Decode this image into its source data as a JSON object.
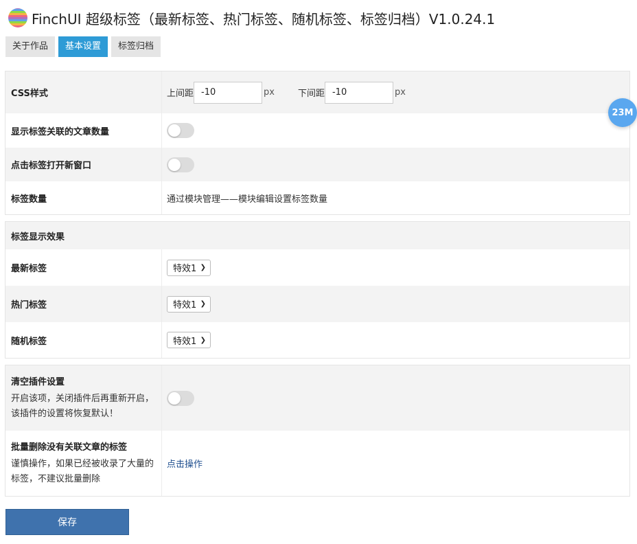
{
  "header": {
    "title": "FinchUI 超级标签（最新标签、热门标签、随机标签、标签归档）V1.0.24.1",
    "logo_icon": "rainbow-sphere-icon"
  },
  "tabs": [
    {
      "label": "关于作品",
      "active": false
    },
    {
      "label": "基本设置",
      "active": true
    },
    {
      "label": "标签归档",
      "active": false
    }
  ],
  "basic": {
    "css_label": "CSS样式",
    "top_margin_label": "上间距",
    "top_margin_value": "-10",
    "bottom_margin_label": "下间距",
    "bottom_margin_value": "-10",
    "unit": "px",
    "show_count_label": "显示标签关联的文章数量",
    "show_count_on": false,
    "new_window_label": "点击标签打开新窗口",
    "new_window_on": false,
    "tag_count_label": "标签数量",
    "tag_count_text": "通过模块管理——模块编辑设置标签数量"
  },
  "effects": {
    "section_title": "标签显示效果",
    "rows": [
      {
        "label": "最新标签",
        "value": "特效1"
      },
      {
        "label": "热门标签",
        "value": "特效1"
      },
      {
        "label": "随机标签",
        "value": "特效1"
      }
    ]
  },
  "danger": {
    "clear_label": "清空插件设置",
    "clear_desc": "开启该项，关闭插件后再重新开启，该插件的设置将恢复默认！",
    "clear_on": false,
    "bulk_label": "批量删除没有关联文章的标签",
    "bulk_desc": "谨慎操作，如果已经被收录了大量的标签，不建议批量删除",
    "bulk_action": "点击操作"
  },
  "badge": "23M",
  "save_label": "保存",
  "colors": {
    "accent": "#2e9bd6",
    "save": "#3f72ad",
    "badge": "#5aa7ef",
    "link": "#1f4f8f"
  }
}
